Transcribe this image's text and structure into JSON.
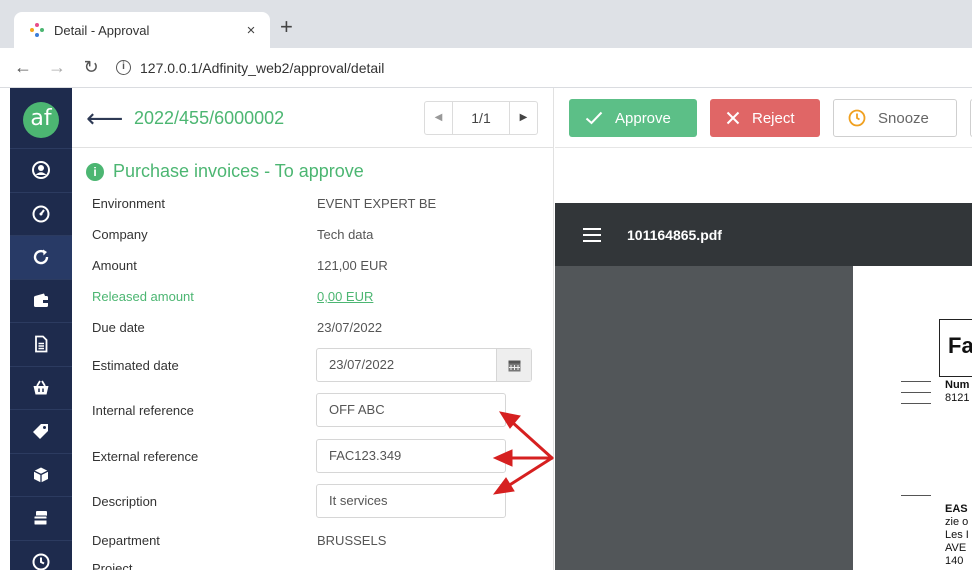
{
  "browser": {
    "tab_title": "Detail - Approval",
    "tab_close": "×",
    "new_tab": "+",
    "url": "127.0.0.1/Adfinity_web2/approval/detail"
  },
  "sidebar": {
    "logo_text": "af",
    "items": [
      {
        "icon": "user-icon"
      },
      {
        "icon": "dashboard-gauge-icon"
      },
      {
        "icon": "refresh-icon"
      },
      {
        "icon": "wallet-icon"
      },
      {
        "icon": "document-icon"
      },
      {
        "icon": "basket-icon"
      },
      {
        "icon": "tag-icon"
      },
      {
        "icon": "box-icon"
      },
      {
        "icon": "card-stack-icon"
      },
      {
        "icon": "clock-icon"
      }
    ]
  },
  "header": {
    "doc_number": "2022/455/6000002",
    "pager": "1/1"
  },
  "status": {
    "icon_text": "i",
    "text": "Purchase invoices - To approve"
  },
  "fields": {
    "environment": {
      "label": "Environment",
      "value": "EVENT EXPERT BE"
    },
    "company": {
      "label": "Company",
      "value": "Tech data"
    },
    "amount": {
      "label": "Amount",
      "value": "121,00 EUR"
    },
    "released_amount": {
      "label": "Released amount",
      "value": "0,00 EUR"
    },
    "due_date": {
      "label": "Due date",
      "value": "23/07/2022"
    },
    "estimated_date": {
      "label": "Estimated date",
      "value": "23/07/2022"
    },
    "internal_reference": {
      "label": "Internal reference",
      "value": "OFF ABC"
    },
    "external_reference": {
      "label": "External reference",
      "value": "FAC123.349"
    },
    "description": {
      "label": "Description",
      "value": "It services"
    },
    "department": {
      "label": "Department",
      "value": "BRUSSELS"
    },
    "project": {
      "label": "Project"
    }
  },
  "actions": {
    "approve": "Approve",
    "reject": "Reject",
    "snooze": "Snooze"
  },
  "pdf": {
    "filename": "101164865.pdf",
    "heading": "Fa",
    "lines": [
      "Num",
      "8121",
      "EAS",
      "zie o",
      "Les I",
      "AVE",
      "140"
    ]
  },
  "colors": {
    "brand_green": "#4cb672",
    "approve": "#5cbf87",
    "reject": "#e06666",
    "sidebar": "#1e2b4d",
    "annotation_arrow": "#d62020"
  }
}
